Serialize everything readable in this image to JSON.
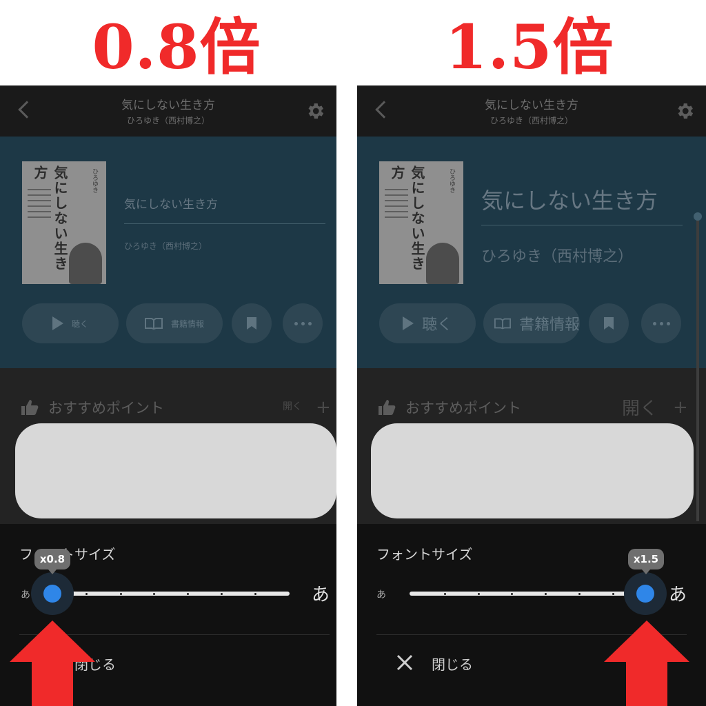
{
  "left": {
    "heading": "0.8倍",
    "nav_title": "気にしない生き方",
    "nav_author": "ひろゆき（西村博之）",
    "cover_title": "気にしない生き方",
    "cover_side": "ひろゆき",
    "book_title": "気にしない生き方",
    "book_author": "ひろゆき（西村博之）",
    "listen_label": "聴く",
    "info_label": "書籍情報",
    "recommend_label": "おすすめポイント",
    "open_label": "開く",
    "font_size_label": "フォントサイズ",
    "small_glyph": "あ",
    "large_glyph": "あ",
    "zoom_value": "x0.8",
    "close_label": "閉じる"
  },
  "right": {
    "heading": "1.5倍",
    "nav_title": "気にしない生き方",
    "nav_author": "ひろゆき（西村博之）",
    "cover_title": "気にしない生き方",
    "cover_side": "ひろゆき",
    "book_title": "気にしない生き方",
    "book_author": "ひろゆき（西村博之）",
    "listen_label": "聴く",
    "info_label": "書籍情報",
    "recommend_label": "おすすめポイント",
    "open_label": "開く",
    "font_size_label": "フォントサイズ",
    "small_glyph": "あ",
    "large_glyph": "あ",
    "zoom_value": "x1.5",
    "close_label": "閉じる"
  },
  "icons": [
    "back-icon",
    "gear-icon",
    "play-icon",
    "book-icon",
    "bookmark-icon",
    "more-icon",
    "thumbs-up-icon",
    "plus-icon",
    "close-icon",
    "arrow-up-icon"
  ],
  "colors": {
    "heading_red": "#f02a2a",
    "slider_blue": "#2f86e8",
    "hero_blue": "#1d3846",
    "sheet_black": "#111111"
  }
}
